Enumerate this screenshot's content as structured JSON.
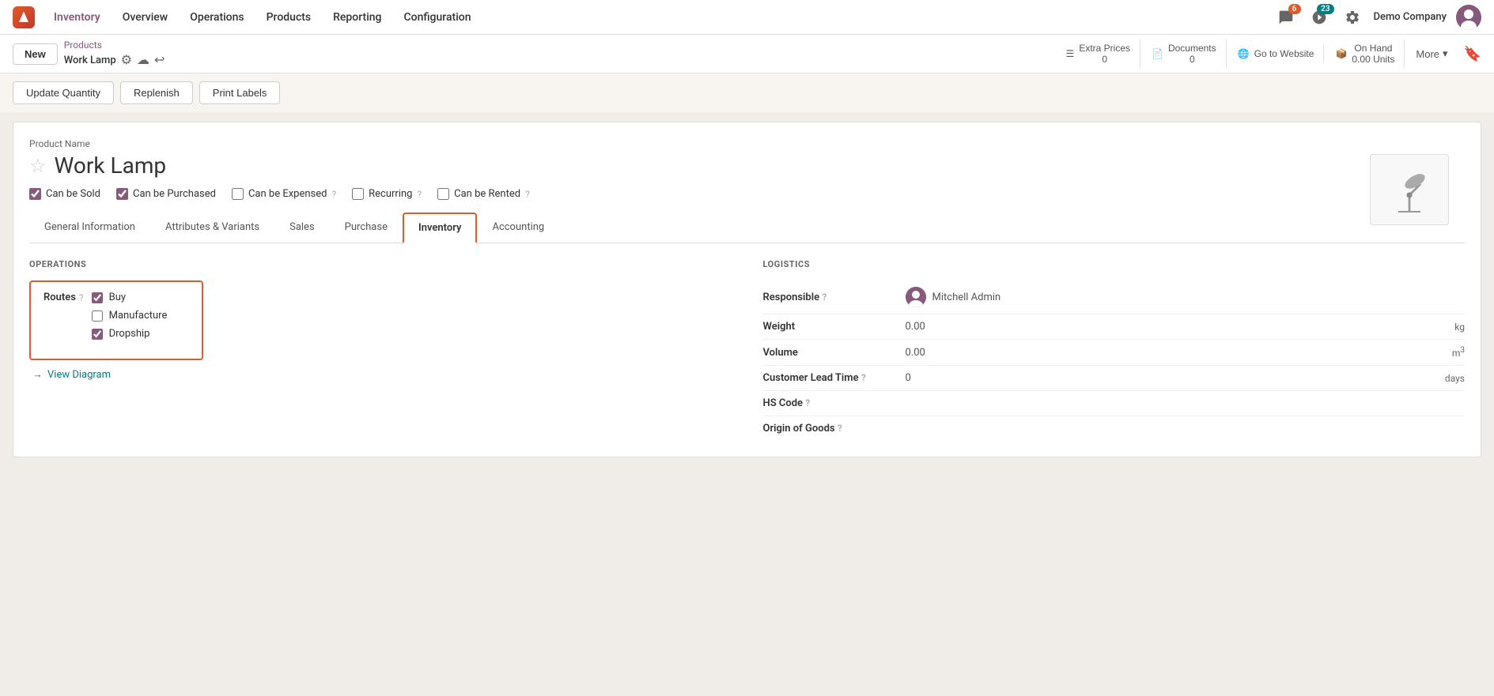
{
  "topNav": {
    "appName": "Inventory",
    "items": [
      {
        "label": "Overview",
        "active": false
      },
      {
        "label": "Operations",
        "active": false
      },
      {
        "label": "Products",
        "active": false
      },
      {
        "label": "Reporting",
        "active": false
      },
      {
        "label": "Configuration",
        "active": false
      }
    ],
    "notifications": [
      {
        "icon": "chat-icon",
        "count": "6",
        "badgeColor": "orange"
      },
      {
        "icon": "clock-icon",
        "count": "23",
        "badgeColor": "blue"
      }
    ],
    "settingsIcon": "settings-icon",
    "companyName": "Demo Company"
  },
  "secondaryToolbar": {
    "newButtonLabel": "New",
    "breadcrumb": "Products",
    "currentPage": "Work Lamp",
    "actionButtons": [
      {
        "icon": "list-icon",
        "label": "Extra Prices",
        "count": "0"
      },
      {
        "icon": "doc-icon",
        "label": "Documents",
        "count": "0"
      },
      {
        "icon": "globe-icon",
        "label": "Go to Website",
        "count": ""
      },
      {
        "icon": "box-icon",
        "label": "On Hand",
        "subLabel": "0.00 Units"
      }
    ],
    "moreLabel": "More"
  },
  "actionBar": {
    "buttons": [
      {
        "label": "Update Quantity"
      },
      {
        "label": "Replenish"
      },
      {
        "label": "Print Labels"
      }
    ]
  },
  "form": {
    "productNameLabel": "Product Name",
    "productTitle": "Work Lamp",
    "checkboxes": [
      {
        "label": "Can be Sold",
        "checked": true,
        "hasHelp": false
      },
      {
        "label": "Can be Purchased",
        "checked": true,
        "hasHelp": false
      },
      {
        "label": "Can be Expensed",
        "checked": false,
        "hasHelp": true
      },
      {
        "label": "Recurring",
        "checked": false,
        "hasHelp": true
      },
      {
        "label": "Can be Rented",
        "checked": false,
        "hasHelp": true
      }
    ],
    "tabs": [
      {
        "label": "General Information",
        "active": false
      },
      {
        "label": "Attributes & Variants",
        "active": false
      },
      {
        "label": "Sales",
        "active": false
      },
      {
        "label": "Purchase",
        "active": false
      },
      {
        "label": "Inventory",
        "active": true
      },
      {
        "label": "Accounting",
        "active": false
      }
    ],
    "inventory": {
      "operationsSectionTitle": "OPERATIONS",
      "routes": {
        "label": "Routes",
        "hasHelp": true,
        "items": [
          {
            "label": "Buy",
            "checked": true
          },
          {
            "label": "Manufacture",
            "checked": false
          },
          {
            "label": "Dropship",
            "checked": true
          }
        ]
      },
      "viewDiagramLabel": "View Diagram",
      "logisticsSectionTitle": "LOGISTICS",
      "logistics": [
        {
          "label": "Responsible",
          "hasHelp": true,
          "value": "Mitchell Admin",
          "type": "user",
          "unit": ""
        },
        {
          "label": "Weight",
          "hasHelp": false,
          "value": "0.00",
          "type": "number",
          "unit": "kg"
        },
        {
          "label": "Volume",
          "hasHelp": false,
          "value": "0.00",
          "type": "number",
          "unit": "m³"
        },
        {
          "label": "Customer Lead Time",
          "hasHelp": true,
          "value": "0",
          "type": "number",
          "unit": "days"
        },
        {
          "label": "HS Code",
          "hasHelp": true,
          "value": "",
          "type": "text",
          "unit": ""
        },
        {
          "label": "Origin of Goods",
          "hasHelp": true,
          "value": "",
          "type": "text",
          "unit": ""
        }
      ]
    }
  }
}
